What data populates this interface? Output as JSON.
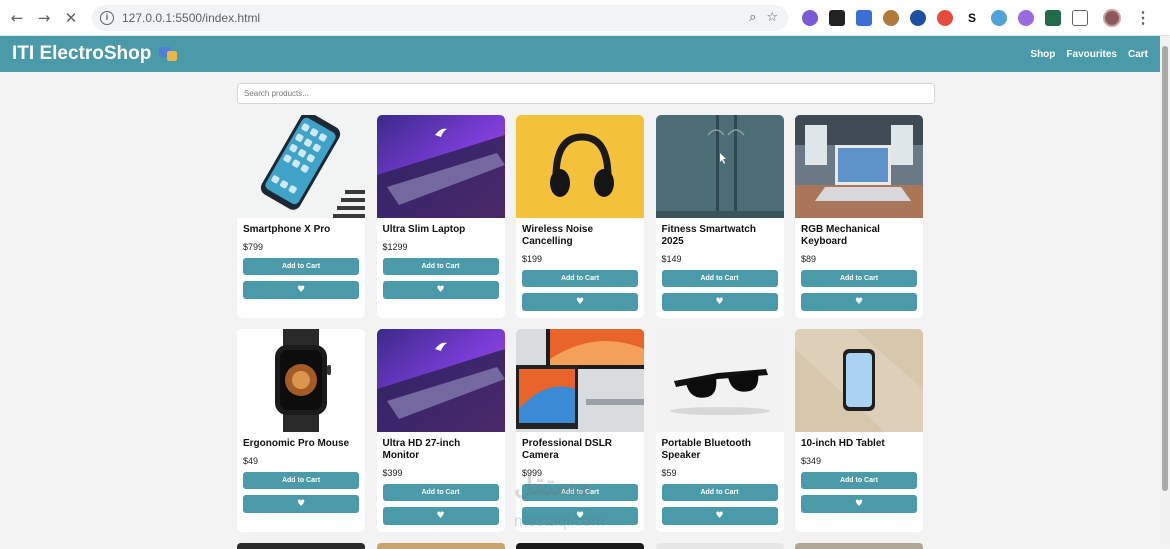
{
  "browser": {
    "url": "127.0.0.1:5500/index.html",
    "back_icon": "arrow-left-icon",
    "forward_icon": "arrow-right-icon",
    "stop_icon": "close-icon"
  },
  "site": {
    "brand": "ITI ElectroShop",
    "nav": [
      "Shop",
      "Favourites",
      "Cart"
    ]
  },
  "search": {
    "placeholder": "Search products..."
  },
  "button_labels": {
    "add_to_cart": "Add to Cart",
    "favourite": "♥"
  },
  "products": [
    {
      "name": "Smartphone X Pro",
      "price": "$799"
    },
    {
      "name": "Ultra Slim Laptop",
      "price": "$1299"
    },
    {
      "name": "Wireless Noise Cancelling",
      "price": "$199"
    },
    {
      "name": "Fitness Smartwatch 2025",
      "price": "$149"
    },
    {
      "name": "RGB Mechanical Keyboard",
      "price": "$89"
    },
    {
      "name": "Ergonomic Pro Mouse",
      "price": "$49"
    },
    {
      "name": "Ultra HD 27-inch Monitor",
      "price": "$399"
    },
    {
      "name": "Professional DSLR Camera",
      "price": "$999"
    },
    {
      "name": "Portable Bluetooth Speaker",
      "price": "$59"
    },
    {
      "name": "10-inch HD Tablet",
      "price": "$349"
    }
  ],
  "watermark": {
    "arabic": "مستقل",
    "latin": "mostaql.com"
  }
}
